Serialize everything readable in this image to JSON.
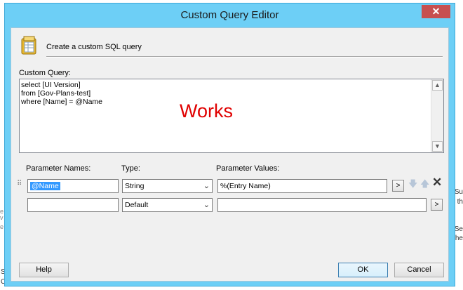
{
  "background": {
    "right_fragments": [
      "Su",
      "th",
      "Se",
      "the"
    ],
    "left_fragments": [
      "e",
      "v",
      "e",
      "S",
      "C"
    ]
  },
  "window": {
    "title": "Custom Query Editor",
    "close_label": "✕",
    "header_text": "Create a custom SQL query",
    "custom_query_label": "Custom Query:",
    "query_text": "select [UI Version]\nfrom [Gov-Plans-test]\nwhere [Name] = @Name",
    "overlay_note": "Works",
    "overlay_color": "#e00000"
  },
  "params": {
    "headers": {
      "names": "Parameter Names:",
      "type": "Type:",
      "values": "Parameter Values:"
    },
    "rows": [
      {
        "name": "@Name",
        "type": "String",
        "value": "%(Entry Name)"
      },
      {
        "name": "",
        "type": "Default",
        "value": ""
      }
    ],
    "browse_label": ">"
  },
  "buttons": {
    "help": "Help",
    "ok": "OK",
    "cancel": "Cancel"
  },
  "icons": [
    "close-icon",
    "database-icon",
    "scroll-up-icon",
    "scroll-down-icon",
    "chevron-down-icon",
    "arrow-down-icon",
    "arrow-up-icon",
    "delete-icon",
    "drag-grip-icon"
  ],
  "colors": {
    "titlebar": "#6dcff6",
    "close": "#c75050",
    "dialog": "#f0f0f0"
  }
}
